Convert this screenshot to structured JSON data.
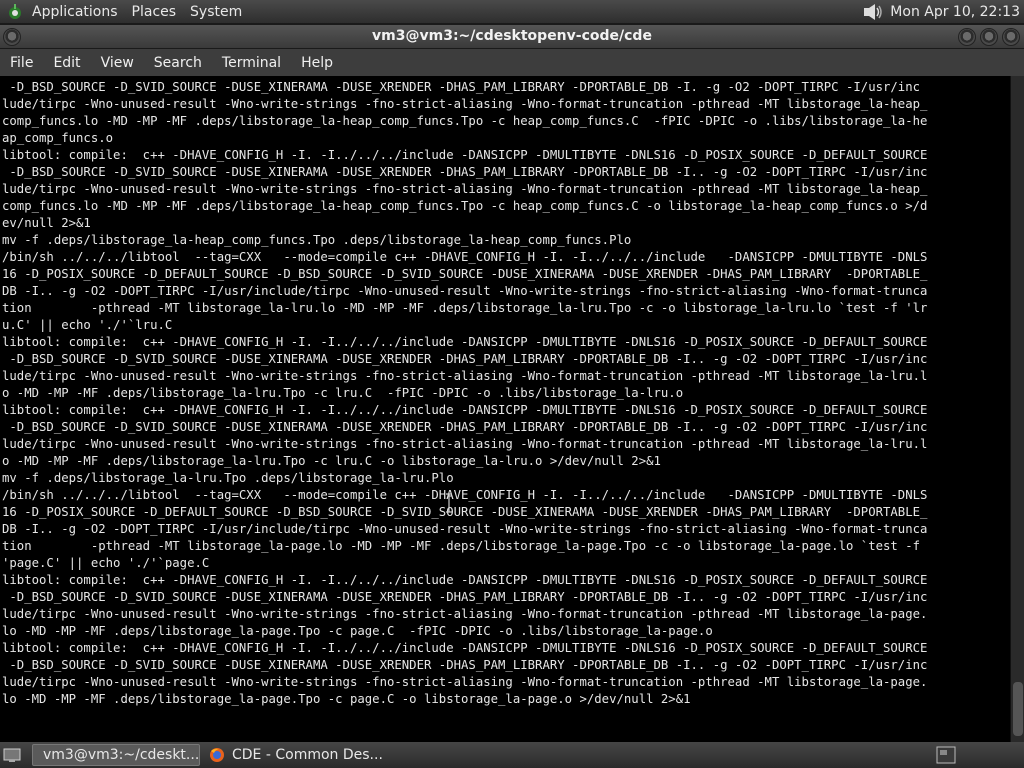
{
  "top_panel": {
    "menus": [
      "Applications",
      "Places",
      "System"
    ],
    "clock": "Mon Apr 10, 22:13"
  },
  "window": {
    "title": "vm3@vm3:~/cdesktopenv-code/cde"
  },
  "menubar": {
    "items": [
      "File",
      "Edit",
      "View",
      "Search",
      "Terminal",
      "Help"
    ]
  },
  "terminal": {
    "lines": [
      " -D_BSD_SOURCE -D_SVID_SOURCE -DUSE_XINERAMA -DUSE_XRENDER -DHAS_PAM_LIBRARY -DPORTABLE_DB -I. -g -O2 -DOPT_TIRPC -I/usr/inc",
      "lude/tirpc -Wno-unused-result -Wno-write-strings -fno-strict-aliasing -Wno-format-truncation -pthread -MT libstorage_la-heap_",
      "comp_funcs.lo -MD -MP -MF .deps/libstorage_la-heap_comp_funcs.Tpo -c heap_comp_funcs.C  -fPIC -DPIC -o .libs/libstorage_la-he",
      "ap_comp_funcs.o",
      "libtool: compile:  c++ -DHAVE_CONFIG_H -I. -I../../../include -DANSICPP -DMULTIBYTE -DNLS16 -D_POSIX_SOURCE -D_DEFAULT_SOURCE",
      " -D_BSD_SOURCE -D_SVID_SOURCE -DUSE_XINERAMA -DUSE_XRENDER -DHAS_PAM_LIBRARY -DPORTABLE_DB -I.. -g -O2 -DOPT_TIRPC -I/usr/inc",
      "lude/tirpc -Wno-unused-result -Wno-write-strings -fno-strict-aliasing -Wno-format-truncation -pthread -MT libstorage_la-heap_",
      "comp_funcs.lo -MD -MP -MF .deps/libstorage_la-heap_comp_funcs.Tpo -c heap_comp_funcs.C -o libstorage_la-heap_comp_funcs.o >/d",
      "ev/null 2>&1",
      "mv -f .deps/libstorage_la-heap_comp_funcs.Tpo .deps/libstorage_la-heap_comp_funcs.Plo",
      "/bin/sh ../../../libtool  --tag=CXX   --mode=compile c++ -DHAVE_CONFIG_H -I. -I../../../include   -DANSICPP -DMULTIBYTE -DNLS",
      "16 -D_POSIX_SOURCE -D_DEFAULT_SOURCE -D_BSD_SOURCE -D_SVID_SOURCE -DUSE_XINERAMA -DUSE_XRENDER -DHAS_PAM_LIBRARY  -DPORTABLE_",
      "DB -I.. -g -O2 -DOPT_TIRPC -I/usr/include/tirpc -Wno-unused-result -Wno-write-strings -fno-strict-aliasing -Wno-format-trunca",
      "tion        -pthread -MT libstorage_la-lru.lo -MD -MP -MF .deps/libstorage_la-lru.Tpo -c -o libstorage_la-lru.lo `test -f 'lr",
      "u.C' || echo './'`lru.C",
      "libtool: compile:  c++ -DHAVE_CONFIG_H -I. -I../../../include -DANSICPP -DMULTIBYTE -DNLS16 -D_POSIX_SOURCE -D_DEFAULT_SOURCE",
      " -D_BSD_SOURCE -D_SVID_SOURCE -DUSE_XINERAMA -DUSE_XRENDER -DHAS_PAM_LIBRARY -DPORTABLE_DB -I.. -g -O2 -DOPT_TIRPC -I/usr/inc",
      "lude/tirpc -Wno-unused-result -Wno-write-strings -fno-strict-aliasing -Wno-format-truncation -pthread -MT libstorage_la-lru.l",
      "o -MD -MP -MF .deps/libstorage_la-lru.Tpo -c lru.C  -fPIC -DPIC -o .libs/libstorage_la-lru.o",
      "libtool: compile:  c++ -DHAVE_CONFIG_H -I. -I../../../include -DANSICPP -DMULTIBYTE -DNLS16 -D_POSIX_SOURCE -D_DEFAULT_SOURCE",
      " -D_BSD_SOURCE -D_SVID_SOURCE -DUSE_XINERAMA -DUSE_XRENDER -DHAS_PAM_LIBRARY -DPORTABLE_DB -I.. -g -O2 -DOPT_TIRPC -I/usr/inc",
      "lude/tirpc -Wno-unused-result -Wno-write-strings -fno-strict-aliasing -Wno-format-truncation -pthread -MT libstorage_la-lru.l",
      "o -MD -MP -MF .deps/libstorage_la-lru.Tpo -c lru.C -o libstorage_la-lru.o >/dev/null 2>&1",
      "mv -f .deps/libstorage_la-lru.Tpo .deps/libstorage_la-lru.Plo",
      "/bin/sh ../../../libtool  --tag=CXX   --mode=compile c++ -DHAVE_CONFIG_H -I. -I../../../include   -DANSICPP -DMULTIBYTE -DNLS",
      "16 -D_POSIX_SOURCE -D_DEFAULT_SOURCE -D_BSD_SOURCE -D_SVID_SOURCE -DUSE_XINERAMA -DUSE_XRENDER -DHAS_PAM_LIBRARY  -DPORTABLE_",
      "DB -I.. -g -O2 -DOPT_TIRPC -I/usr/include/tirpc -Wno-unused-result -Wno-write-strings -fno-strict-aliasing -Wno-format-trunca",
      "tion        -pthread -MT libstorage_la-page.lo -MD -MP -MF .deps/libstorage_la-page.Tpo -c -o libstorage_la-page.lo `test -f",
      "'page.C' || echo './'`page.C",
      "libtool: compile:  c++ -DHAVE_CONFIG_H -I. -I../../../include -DANSICPP -DMULTIBYTE -DNLS16 -D_POSIX_SOURCE -D_DEFAULT_SOURCE",
      " -D_BSD_SOURCE -D_SVID_SOURCE -DUSE_XINERAMA -DUSE_XRENDER -DHAS_PAM_LIBRARY -DPORTABLE_DB -I.. -g -O2 -DOPT_TIRPC -I/usr/inc",
      "lude/tirpc -Wno-unused-result -Wno-write-strings -fno-strict-aliasing -Wno-format-truncation -pthread -MT libstorage_la-page.",
      "lo -MD -MP -MF .deps/libstorage_la-page.Tpo -c page.C  -fPIC -DPIC -o .libs/libstorage_la-page.o",
      "libtool: compile:  c++ -DHAVE_CONFIG_H -I. -I../../../include -DANSICPP -DMULTIBYTE -DNLS16 -D_POSIX_SOURCE -D_DEFAULT_SOURCE",
      " -D_BSD_SOURCE -D_SVID_SOURCE -DUSE_XINERAMA -DUSE_XRENDER -DHAS_PAM_LIBRARY -DPORTABLE_DB -I.. -g -O2 -DOPT_TIRPC -I/usr/inc",
      "lude/tirpc -Wno-unused-result -Wno-write-strings -fno-strict-aliasing -Wno-format-truncation -pthread -MT libstorage_la-page.",
      "lo -MD -MP -MF .deps/libstorage_la-page.Tpo -c page.C -o libstorage_la-page.o >/dev/null 2>&1"
    ]
  },
  "taskbar": {
    "tasks": [
      {
        "label": "vm3@vm3:~/cdeskt...",
        "icon": "terminal-icon"
      },
      {
        "label": "CDE - Common Des...",
        "icon": "firefox-icon"
      }
    ]
  }
}
